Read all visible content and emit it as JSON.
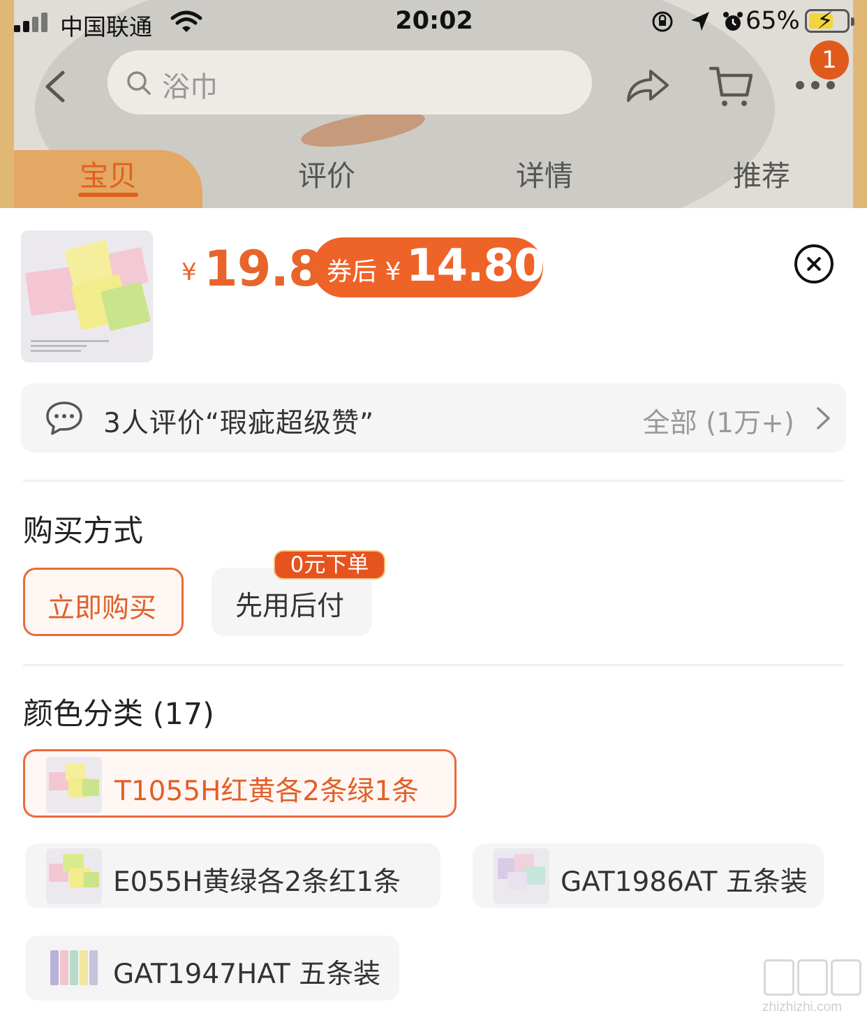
{
  "status_bar": {
    "carrier": "中国联通",
    "time": "20:02",
    "battery_percent": "65%"
  },
  "nav": {
    "search_text": "浴巾",
    "cart_badge": "1"
  },
  "tabs": [
    "宝贝",
    "评价",
    "详情",
    "推荐"
  ],
  "product": {
    "currency": "¥",
    "price": "19.8",
    "coupon_label": "券后 ¥",
    "coupon_price": "14.80"
  },
  "review_summary": {
    "text": "3人评价“瑕疵超级赞”",
    "all_label": "全部 (1万+)"
  },
  "purchase": {
    "title": "购买方式",
    "options": [
      "立即购买",
      "先用后付"
    ],
    "badge": "0元下单"
  },
  "color": {
    "title": "颜色分类 (17)",
    "skus": [
      "T1055H红黄各2条绿1条",
      "E055H黄绿各2条红1条",
      "GAT1986AT 五条装",
      "GAT1947HAT 五条装"
    ]
  },
  "watermark": "zhizhizhi.com",
  "colors": {
    "accent": "#ee6328",
    "price": "#e8642a",
    "badge": "#e05a1d"
  }
}
